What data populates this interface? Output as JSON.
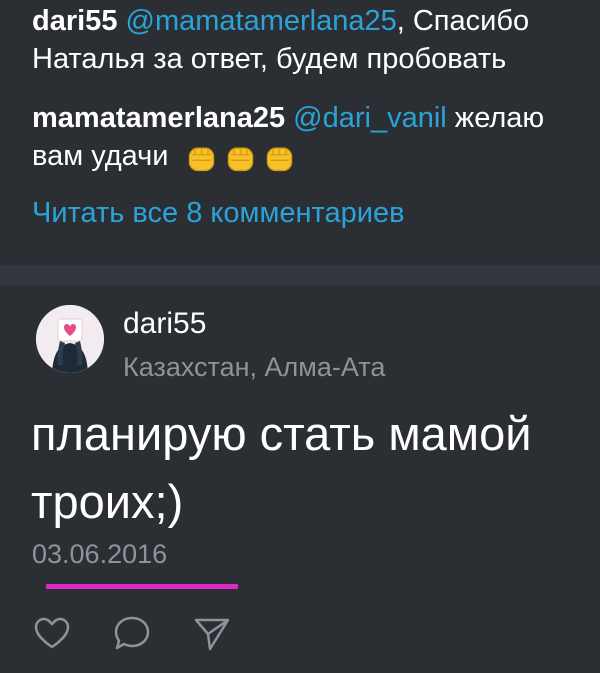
{
  "comments": [
    {
      "author": "dari55",
      "mention": "@mamatamerlana25",
      "text_inline": ", Спасибо",
      "text_line2": "Наталья за ответ, будем пробовать"
    },
    {
      "author": "mamatamerlana25",
      "mention": "@dari_vanil",
      "text_inline": " желаю",
      "text_line2": "вам удачи",
      "emoji": [
        "raised-fist",
        "raised-fist",
        "raised-fist"
      ]
    }
  ],
  "read_all_label": "Читать все 8 комментариев",
  "post": {
    "username": "dari55",
    "location": "Казахстан, Алма-Ата",
    "text_line1": "планирую стать мамой",
    "text_line2": "троих;)",
    "date": "03.06.2016"
  },
  "colors": {
    "background": "#2b2f34",
    "link": "#2aa3d9",
    "secondary_text": "#8e939a",
    "highlight_underline": "#e028c8"
  },
  "icons": {
    "like": "heart-icon",
    "comment": "comment-bubble-icon",
    "share": "send-arrow-icon"
  }
}
